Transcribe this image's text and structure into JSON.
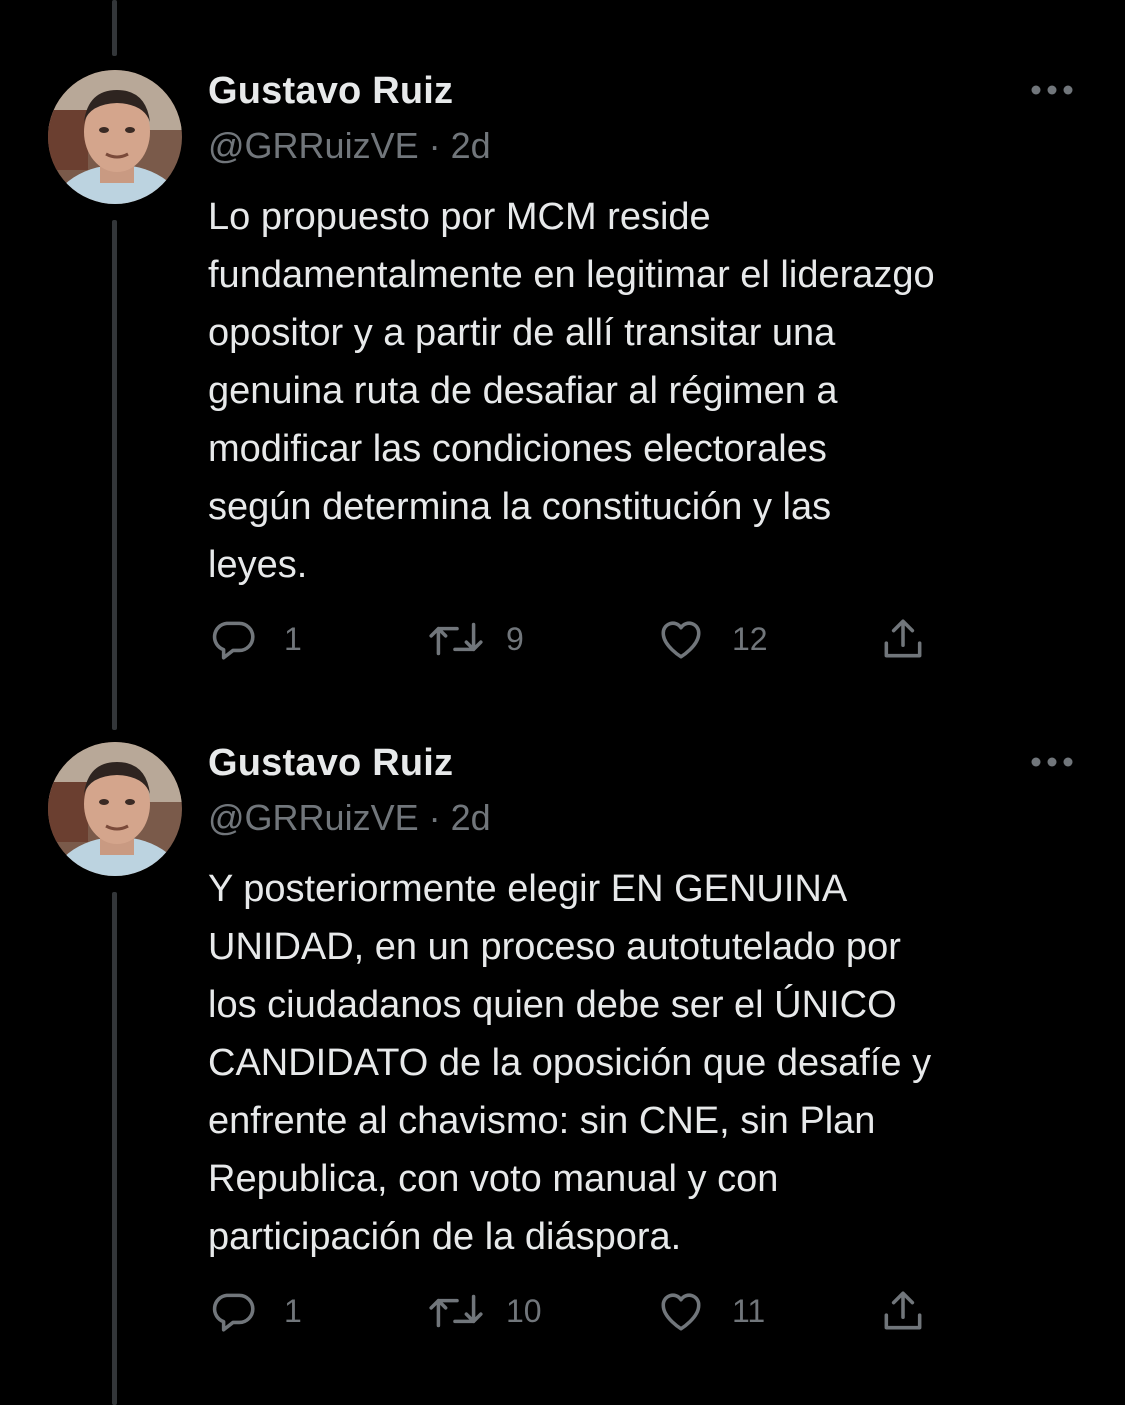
{
  "colors": {
    "background": "#000000",
    "primary_text": "#e7e9ea",
    "secondary_text": "#71767b",
    "thread_line": "#333639"
  },
  "tweets": [
    {
      "author_name": "Gustavo Ruiz",
      "handle_time": "@GRRuizVE · 2d",
      "text": "Lo propuesto por MCM reside\nfundamentalmente en legitimar el liderazgo\nopositor y a partir de allí transitar una\ngenuina ruta de desafiar al régimen a\nmodificar las condiciones electorales\nsegún determina la constitución y las\nleyes.",
      "reply_count": "1",
      "retweet_count": "9",
      "like_count": "12",
      "icons": [
        "reply-icon",
        "retweet-icon",
        "like-icon",
        "share-icon",
        "more-icon"
      ]
    },
    {
      "author_name": "Gustavo Ruiz",
      "handle_time": "@GRRuizVE · 2d",
      "text": "Y posteriormente elegir EN GENUINA\nUNIDAD, en un proceso autotutelado por\nlos ciudadanos quien debe ser el ÚNICO\nCANDIDATO de la oposición que desafíe y\nenfrente al chavismo: sin CNE, sin Plan\nRepublica, con voto manual y con\nparticipación de la diáspora.",
      "reply_count": "1",
      "retweet_count": "10",
      "like_count": "11",
      "icons": [
        "reply-icon",
        "retweet-icon",
        "like-icon",
        "share-icon",
        "more-icon"
      ]
    }
  ]
}
